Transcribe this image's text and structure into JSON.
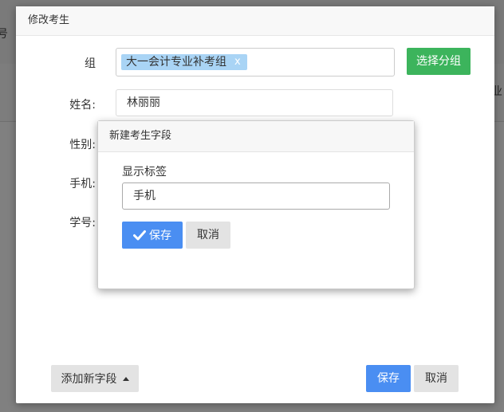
{
  "background": {
    "fragment_left": "号",
    "fragment_right": "业"
  },
  "modal": {
    "title": "修改考生",
    "fields": {
      "group_label": "组",
      "group_tag": "大一会计专业补考组",
      "group_tag_remove": "x",
      "select_group_button": "选择分组",
      "name_label": "姓名:",
      "name_value": "林丽丽",
      "gender_label": "性别:",
      "phone_label": "手机:",
      "student_id_label": "学号:"
    },
    "footer": {
      "add_field_button": "添加新字段",
      "save_button": "保存",
      "cancel_button": "取消"
    }
  },
  "popup": {
    "title": "新建考生字段",
    "display_label_caption": "显示标签",
    "display_label_value": "手机",
    "save_button": "保存",
    "cancel_button": "取消"
  },
  "colors": {
    "primary": "#4a8ef2",
    "success": "#3cb45c",
    "tag_bg": "#a9d4f5",
    "overlay": "#808080"
  },
  "icons": {
    "check": "check-icon",
    "caret": "caret-up-icon"
  }
}
